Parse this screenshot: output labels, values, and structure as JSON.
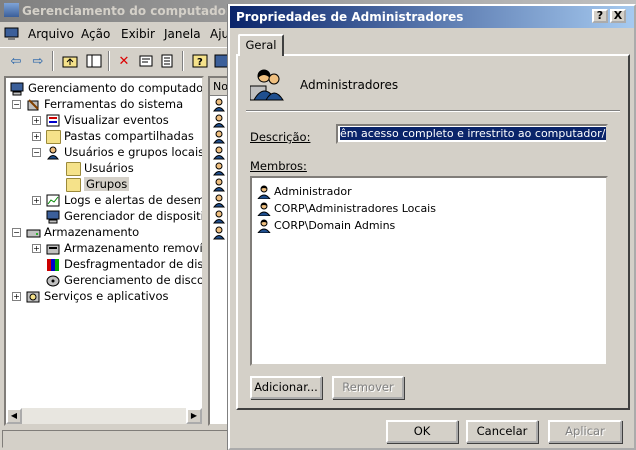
{
  "mmc": {
    "title": "Gerenciamento do computador",
    "menu": [
      "Arquivo",
      "Ação",
      "Exibir",
      "Janela",
      "Aju"
    ],
    "tree": [
      {
        "label": "Gerenciamento do computador (loca",
        "level": 0
      },
      {
        "label": "Ferramentas do sistema",
        "level": 1
      },
      {
        "label": "Visualizar eventos",
        "level": 2
      },
      {
        "label": "Pastas compartilhadas",
        "level": 2
      },
      {
        "label": "Usuários e grupos locais",
        "level": 2
      },
      {
        "label": "Usuários",
        "level": 3
      },
      {
        "label": "Grupos",
        "level": 3
      },
      {
        "label": "Logs e alertas de desempen",
        "level": 2
      },
      {
        "label": "Gerenciador de dispositivos",
        "level": 2
      },
      {
        "label": "Armazenamento",
        "level": 1
      },
      {
        "label": "Armazenamento removível",
        "level": 2
      },
      {
        "label": "Desfragmentador de disco",
        "level": 2
      },
      {
        "label": "Gerenciamento de disco",
        "level": 2
      },
      {
        "label": "Serviços e aplicativos",
        "level": 1
      }
    ],
    "list_header": "No"
  },
  "dialog": {
    "title": "Propriedades de Administradores",
    "help_btn": "?",
    "close_btn": "X",
    "tab": "Geral",
    "group_name": "Administradores",
    "description_label": "Descrição:",
    "description_value": "êm acesso completo e irrestrito ao computador/domínio",
    "members_label": "Membros:",
    "members": [
      "Administrador",
      "CORP\\Administradores Locais",
      "CORP\\Domain Admins"
    ],
    "add_btn": "Adicionar...",
    "remove_btn": "Remover",
    "ok_btn": "OK",
    "cancel_btn": "Cancelar",
    "apply_btn": "Aplicar"
  }
}
